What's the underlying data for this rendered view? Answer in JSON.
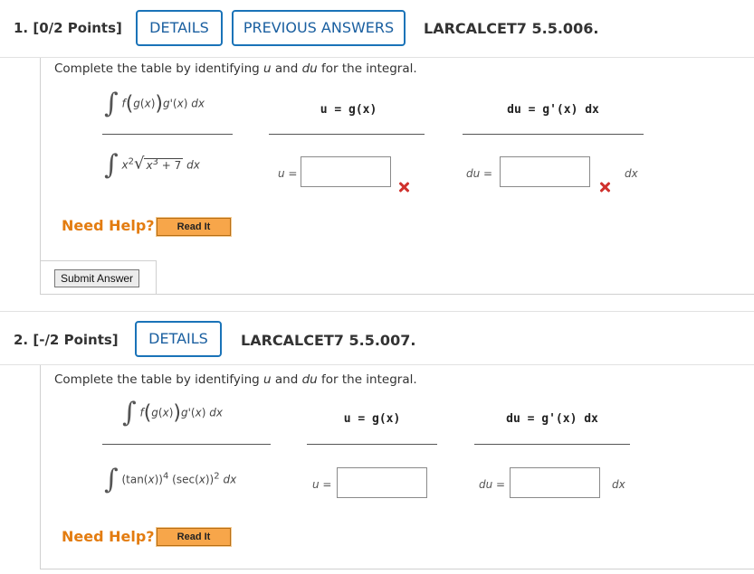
{
  "q1": {
    "number": "1.",
    "points": "[0/2 Points]",
    "details_label": "DETAILS",
    "prev_answers_label": "PREVIOUS ANSWERS",
    "code": "LARCALCET7 5.5.006.",
    "instruction_pre": "Complete the table by identifying ",
    "instruction_u": "u",
    "instruction_mid": " and ",
    "instruction_du": "du",
    "instruction_post": " for the integral.",
    "col_integral": "∫ f(g(x))g'(x) dx",
    "col_u": "u = g(x)",
    "col_du": "du = g'(x) dx",
    "integrand": "x² √(x³ + 7) dx",
    "u_label": "u =",
    "du_label": "du =",
    "dx_suffix": "dx",
    "u_value": "",
    "du_value": "",
    "u_status": "incorrect",
    "du_status": "incorrect",
    "help_label": "Need Help?",
    "read_it_label": "Read It",
    "submit_label": "Submit Answer"
  },
  "q2": {
    "number": "2.",
    "points": "[-/2 Points]",
    "details_label": "DETAILS",
    "code": "LARCALCET7 5.5.007.",
    "instruction_pre": "Complete the table by identifying ",
    "instruction_u": "u",
    "instruction_mid": " and ",
    "instruction_du": "du",
    "instruction_post": " for the integral.",
    "col_u": "u = g(x)",
    "col_du": "du = g'(x) dx",
    "integrand": "(tan(x))⁴ (sec(x))² dx",
    "u_label": "u =",
    "du_label": "du =",
    "dx_suffix": "dx",
    "u_value": "",
    "du_value": "",
    "help_label": "Need Help?",
    "read_it_label": "Read It"
  },
  "colors": {
    "accent_blue": "#1a73b8",
    "help_orange": "#e37c10",
    "error_red": "#d0312d",
    "read_it_bg": "#f7a64a"
  }
}
